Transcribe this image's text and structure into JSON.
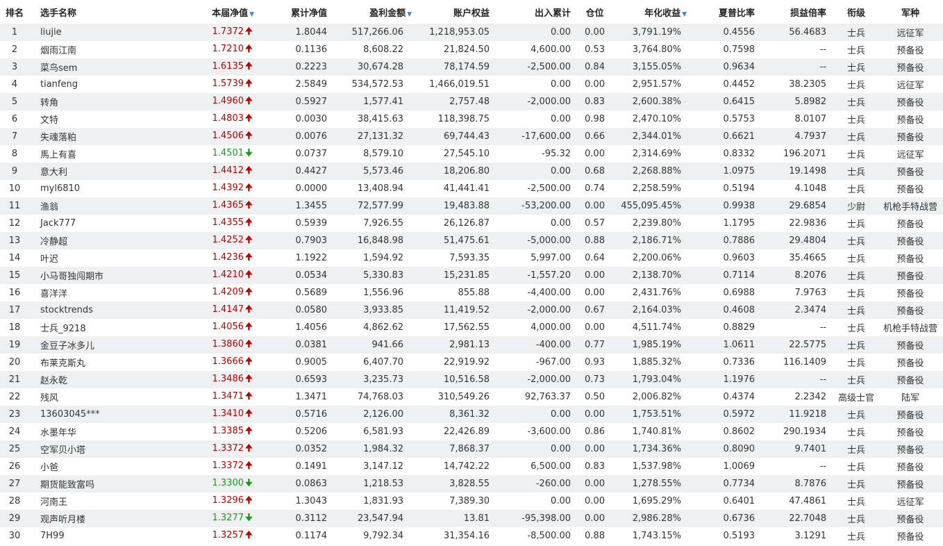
{
  "columns": {
    "rank": "排名",
    "name": "选手名称",
    "nav": "本届净值",
    "cumnav": "累计净值",
    "profit": "盈利金额",
    "equity": "账户权益",
    "flow": "出入累计",
    "position": "仓位",
    "annual": "年化收益",
    "sharpe": "夏普比率",
    "pl_ratio": "损益倍率",
    "rank_title": "衔级",
    "army": "军种"
  },
  "sort_icon": "▼",
  "arrows": {
    "up": "🠉",
    "down": "🠋"
  },
  "colors": {
    "up": "#c00000",
    "down": "#1a9a1a",
    "sort": "#3a8ad8",
    "row_alt": "#eef0f2"
  },
  "rows": [
    {
      "rank": "1",
      "name": "liujie",
      "nav": "1.7372",
      "dir": "up",
      "cumnav": "1.8044",
      "profit": "517,266.06",
      "equity": "1,218,953.05",
      "flow": "0.00",
      "position": "0.00",
      "annual": "3,791.19%",
      "sharpe": "0.4556",
      "pl_ratio": "56.4683",
      "rank_title": "士兵",
      "army": "远征军"
    },
    {
      "rank": "2",
      "name": "烟雨江南",
      "nav": "1.7210",
      "dir": "up",
      "cumnav": "0.1136",
      "profit": "8,608.22",
      "equity": "21,824.50",
      "flow": "4,600.00",
      "position": "0.53",
      "annual": "3,764.80%",
      "sharpe": "0.7598",
      "pl_ratio": "--",
      "rank_title": "士兵",
      "army": "预备役"
    },
    {
      "rank": "3",
      "name": "菜鸟sem",
      "nav": "1.6135",
      "dir": "up",
      "cumnav": "0.2223",
      "profit": "30,674.28",
      "equity": "78,174.59",
      "flow": "-2,500.00",
      "position": "0.84",
      "annual": "3,155.05%",
      "sharpe": "0.9634",
      "pl_ratio": "--",
      "rank_title": "士兵",
      "army": "预备役"
    },
    {
      "rank": "4",
      "name": "tianfeng",
      "nav": "1.5739",
      "dir": "up",
      "cumnav": "2.5849",
      "profit": "534,572.53",
      "equity": "1,466,019.51",
      "flow": "0.00",
      "position": "0.00",
      "annual": "2,951.57%",
      "sharpe": "0.4452",
      "pl_ratio": "38.2305",
      "rank_title": "士兵",
      "army": "远征军"
    },
    {
      "rank": "5",
      "name": "转角",
      "nav": "1.4960",
      "dir": "up",
      "cumnav": "0.5927",
      "profit": "1,577.41",
      "equity": "2,757.48",
      "flow": "-2,000.00",
      "position": "0.83",
      "annual": "2,600.38%",
      "sharpe": "0.6415",
      "pl_ratio": "5.8982",
      "rank_title": "士兵",
      "army": "预备役"
    },
    {
      "rank": "6",
      "name": "文特",
      "nav": "1.4803",
      "dir": "up",
      "cumnav": "0.0030",
      "profit": "38,415.63",
      "equity": "118,398.75",
      "flow": "0.00",
      "position": "0.98",
      "annual": "2,470.10%",
      "sharpe": "0.5753",
      "pl_ratio": "8.0107",
      "rank_title": "士兵",
      "army": "预备役"
    },
    {
      "rank": "7",
      "name": "失魂落粕",
      "nav": "1.4506",
      "dir": "up",
      "cumnav": "0.0076",
      "profit": "27,131.32",
      "equity": "69,744.43",
      "flow": "-17,600.00",
      "position": "0.66",
      "annual": "2,344.01%",
      "sharpe": "0.6621",
      "pl_ratio": "4.7937",
      "rank_title": "士兵",
      "army": "预备役"
    },
    {
      "rank": "8",
      "name": "馬上有喜",
      "nav": "1.4501",
      "dir": "down",
      "cumnav": "0.0737",
      "profit": "8,579.10",
      "equity": "27,545.10",
      "flow": "-95.32",
      "position": "0.00",
      "annual": "2,314.69%",
      "sharpe": "0.8332",
      "pl_ratio": "196.2071",
      "rank_title": "士兵",
      "army": "远征军"
    },
    {
      "rank": "9",
      "name": "意大利",
      "nav": "1.4412",
      "dir": "up",
      "cumnav": "0.4427",
      "profit": "5,573.46",
      "equity": "18,206.80",
      "flow": "0.00",
      "position": "0.68",
      "annual": "2,268.88%",
      "sharpe": "1.0975",
      "pl_ratio": "19.1498",
      "rank_title": "士兵",
      "army": "预备役"
    },
    {
      "rank": "10",
      "name": "myl6810",
      "nav": "1.4392",
      "dir": "up",
      "cumnav": "0.0000",
      "profit": "13,408.94",
      "equity": "41,441.41",
      "flow": "-2,500.00",
      "position": "0.74",
      "annual": "2,258.59%",
      "sharpe": "0.5194",
      "pl_ratio": "4.1048",
      "rank_title": "士兵",
      "army": "预备役"
    },
    {
      "rank": "11",
      "name": "渔翁",
      "nav": "1.4365",
      "dir": "up",
      "cumnav": "1.3455",
      "profit": "72,577.99",
      "equity": "19,483.88",
      "flow": "-53,200.00",
      "position": "0.00",
      "annual": "455,095.45%",
      "sharpe": "0.9938",
      "pl_ratio": "29.6854",
      "rank_title": "少尉",
      "army": "机枪手特战营"
    },
    {
      "rank": "12",
      "name": "Jack777",
      "nav": "1.4355",
      "dir": "up",
      "cumnav": "0.5939",
      "profit": "7,926.55",
      "equity": "26,126.87",
      "flow": "0.00",
      "position": "0.57",
      "annual": "2,239.80%",
      "sharpe": "1.1795",
      "pl_ratio": "22.9836",
      "rank_title": "士兵",
      "army": "预备役"
    },
    {
      "rank": "13",
      "name": "冷静超",
      "nav": "1.4252",
      "dir": "up",
      "cumnav": "0.7903",
      "profit": "16,848.98",
      "equity": "51,475.61",
      "flow": "-5,000.00",
      "position": "0.88",
      "annual": "2,186.71%",
      "sharpe": "0.7886",
      "pl_ratio": "29.4804",
      "rank_title": "士兵",
      "army": "预备役"
    },
    {
      "rank": "14",
      "name": "叶迟",
      "nav": "1.4236",
      "dir": "up",
      "cumnav": "1.1922",
      "profit": "1,594.92",
      "equity": "7,593.35",
      "flow": "5,997.00",
      "position": "0.64",
      "annual": "2,200.06%",
      "sharpe": "0.9603",
      "pl_ratio": "35.4665",
      "rank_title": "士兵",
      "army": "预备役"
    },
    {
      "rank": "15",
      "name": "小马哥独闯期市",
      "nav": "1.4210",
      "dir": "up",
      "cumnav": "0.0534",
      "profit": "5,330.83",
      "equity": "15,231.85",
      "flow": "-1,557.20",
      "position": "0.00",
      "annual": "2,138.70%",
      "sharpe": "0.7114",
      "pl_ratio": "8.2076",
      "rank_title": "士兵",
      "army": "预备役"
    },
    {
      "rank": "16",
      "name": "喜洋洋",
      "nav": "1.4209",
      "dir": "up",
      "cumnav": "0.5689",
      "profit": "1,556.96",
      "equity": "855.88",
      "flow": "-4,400.00",
      "position": "0.00",
      "annual": "2,431.76%",
      "sharpe": "0.6988",
      "pl_ratio": "7.9763",
      "rank_title": "士兵",
      "army": "预备役"
    },
    {
      "rank": "17",
      "name": "stocktrends",
      "nav": "1.4147",
      "dir": "up",
      "cumnav": "0.0580",
      "profit": "3,933.85",
      "equity": "11,419.52",
      "flow": "-2,000.00",
      "position": "0.67",
      "annual": "2,164.03%",
      "sharpe": "0.4608",
      "pl_ratio": "2.3474",
      "rank_title": "士兵",
      "army": "预备役"
    },
    {
      "rank": "18",
      "name": "士兵_9218",
      "nav": "1.4056",
      "dir": "up",
      "cumnav": "1.4056",
      "profit": "4,862.62",
      "equity": "17,562.55",
      "flow": "4,000.00",
      "position": "0.00",
      "annual": "4,511.74%",
      "sharpe": "0.8829",
      "pl_ratio": "--",
      "rank_title": "士兵",
      "army": "机枪手特战营"
    },
    {
      "rank": "19",
      "name": "金豆子冰多儿",
      "nav": "1.3860",
      "dir": "up",
      "cumnav": "0.0381",
      "profit": "941.66",
      "equity": "2,981.13",
      "flow": "-400.00",
      "position": "0.77",
      "annual": "1,985.19%",
      "sharpe": "1.0611",
      "pl_ratio": "22.5775",
      "rank_title": "士兵",
      "army": "预备役"
    },
    {
      "rank": "20",
      "name": "布莱克斯丸",
      "nav": "1.3666",
      "dir": "up",
      "cumnav": "0.9005",
      "profit": "6,407.70",
      "equity": "22,919.92",
      "flow": "-967.00",
      "position": "0.93",
      "annual": "1,885.32%",
      "sharpe": "0.7336",
      "pl_ratio": "116.1409",
      "rank_title": "士兵",
      "army": "预备役"
    },
    {
      "rank": "21",
      "name": "赵永乾",
      "nav": "1.3486",
      "dir": "up",
      "cumnav": "0.6593",
      "profit": "3,235.73",
      "equity": "10,516.58",
      "flow": "-2,000.00",
      "position": "0.73",
      "annual": "1,793.04%",
      "sharpe": "1.1976",
      "pl_ratio": "--",
      "rank_title": "士兵",
      "army": "预备役"
    },
    {
      "rank": "22",
      "name": "残风",
      "nav": "1.3471",
      "dir": "up",
      "cumnav": "1.3471",
      "profit": "74,768.03",
      "equity": "310,549.26",
      "flow": "92,763.37",
      "position": "0.50",
      "annual": "2,006.82%",
      "sharpe": "0.4374",
      "pl_ratio": "2.2342",
      "rank_title": "高级士官",
      "army": "陆军"
    },
    {
      "rank": "23",
      "name": "13603045***",
      "nav": "1.3410",
      "dir": "up",
      "cumnav": "0.5716",
      "profit": "2,126.00",
      "equity": "8,361.32",
      "flow": "0.00",
      "position": "0.00",
      "annual": "1,753.51%",
      "sharpe": "0.5972",
      "pl_ratio": "11.9218",
      "rank_title": "士兵",
      "army": "预备役"
    },
    {
      "rank": "24",
      "name": "水墨年华",
      "nav": "1.3385",
      "dir": "up",
      "cumnav": "0.5206",
      "profit": "6,581.93",
      "equity": "22,426.89",
      "flow": "-3,600.00",
      "position": "0.86",
      "annual": "1,740.81%",
      "sharpe": "0.8602",
      "pl_ratio": "290.1934",
      "rank_title": "士兵",
      "army": "预备役"
    },
    {
      "rank": "25",
      "name": "空军贝小塔",
      "nav": "1.3372",
      "dir": "up",
      "cumnav": "0.0352",
      "profit": "1,984.32",
      "equity": "7,868.37",
      "flow": "0.00",
      "position": "0.00",
      "annual": "1,734.36%",
      "sharpe": "0.8090",
      "pl_ratio": "9.7401",
      "rank_title": "士兵",
      "army": "预备役"
    },
    {
      "rank": "26",
      "name": "小爸",
      "nav": "1.3372",
      "dir": "up",
      "cumnav": "0.1491",
      "profit": "3,147.12",
      "equity": "14,742.22",
      "flow": "6,500.00",
      "position": "0.83",
      "annual": "1,537.98%",
      "sharpe": "1.0069",
      "pl_ratio": "--",
      "rank_title": "士兵",
      "army": "预备役"
    },
    {
      "rank": "27",
      "name": "期货能致富吗",
      "nav": "1.3300",
      "dir": "down",
      "cumnav": "0.0863",
      "profit": "1,218.53",
      "equity": "3,828.55",
      "flow": "-260.00",
      "position": "0.00",
      "annual": "1,278.55%",
      "sharpe": "0.7734",
      "pl_ratio": "8.7876",
      "rank_title": "士兵",
      "army": "预备役"
    },
    {
      "rank": "28",
      "name": "河南王",
      "nav": "1.3296",
      "dir": "up",
      "cumnav": "1.3043",
      "profit": "1,831.93",
      "equity": "7,389.30",
      "flow": "0.00",
      "position": "0.00",
      "annual": "1,695.29%",
      "sharpe": "0.6401",
      "pl_ratio": "47.4861",
      "rank_title": "士兵",
      "army": "远征军"
    },
    {
      "rank": "29",
      "name": "观声听月楼",
      "nav": "1.3277",
      "dir": "down",
      "cumnav": "0.3112",
      "profit": "23,547.94",
      "equity": "13.81",
      "flow": "-95,398.00",
      "position": "0.00",
      "annual": "2,986.28%",
      "sharpe": "0.6736",
      "pl_ratio": "22.7048",
      "rank_title": "士兵",
      "army": "预备役"
    },
    {
      "rank": "30",
      "name": "7H99",
      "nav": "1.3257",
      "dir": "up",
      "cumnav": "0.1174",
      "profit": "9,792.34",
      "equity": "31,354.16",
      "flow": "-8,500.00",
      "position": "0.88",
      "annual": "1,743.15%",
      "sharpe": "0.5193",
      "pl_ratio": "3.1291",
      "rank_title": "士兵",
      "army": "预备役"
    }
  ]
}
